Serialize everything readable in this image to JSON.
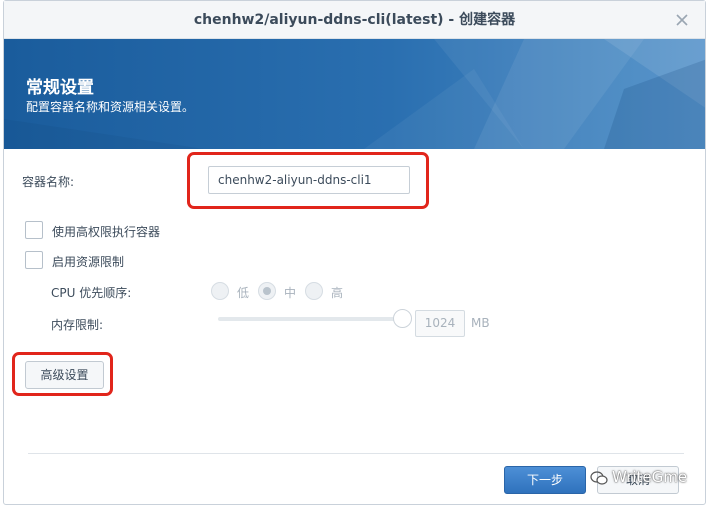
{
  "window": {
    "title": "chenhw2/aliyun-ddns-cli(latest) - 创建容器"
  },
  "banner": {
    "title": "常规设置",
    "subtitle": "配置容器名称和资源相关设置。"
  },
  "form": {
    "container_name_label": "容器名称:",
    "container_name_value": "chenhw2-aliyun-ddns-cli1",
    "high_privilege_label": "使用高权限执行容器",
    "high_privilege_checked": false,
    "resource_limit_label": "启用资源限制",
    "resource_limit_checked": false,
    "cpu_priority_label": "CPU 优先顺序:",
    "cpu_options": [
      "低",
      "中",
      "高"
    ],
    "cpu_selected": "中",
    "memory_limit_label": "内存限制:",
    "memory_value": "1024",
    "memory_unit": "MB"
  },
  "buttons": {
    "advanced": "高级设置",
    "next": "下一步",
    "cancel": "取消"
  },
  "watermark": {
    "text": "WriteGme"
  },
  "colors": {
    "accent": "#2f72bd",
    "highlight": "#e1251b",
    "banner": "#1a5c9c"
  },
  "icons": [
    "close-icon",
    "wechat-icon"
  ]
}
